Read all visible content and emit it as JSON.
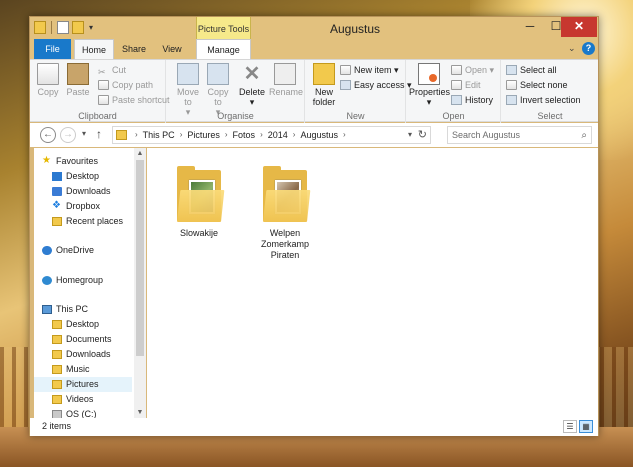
{
  "window": {
    "title": "Augustus",
    "contextual_tab_group": "Picture Tools",
    "controls": {
      "minimize": "─",
      "maximize": "☐",
      "close": "✕"
    }
  },
  "ribbon_tabs": [
    "File",
    "Home",
    "Share",
    "View",
    "Manage"
  ],
  "ribbon": {
    "clipboard": {
      "label": "Clipboard",
      "copy": "Copy",
      "paste": "Paste",
      "cut": "Cut",
      "copy_path": "Copy path",
      "paste_shortcut": "Paste shortcut"
    },
    "organise": {
      "label": "Organise",
      "move_to": "Move to",
      "copy_to": "Copy to",
      "delete": "Delete",
      "rename": "Rename"
    },
    "new": {
      "label": "New",
      "new_folder": "New folder",
      "new_item": "New item",
      "easy_access": "Easy access"
    },
    "open": {
      "label": "Open",
      "properties": "Properties",
      "open": "Open",
      "edit": "Edit",
      "history": "History"
    },
    "select": {
      "label": "Select",
      "select_all": "Select all",
      "select_none": "Select none",
      "invert_selection": "Invert selection"
    }
  },
  "address": {
    "breadcrumbs": [
      "This PC",
      "Pictures",
      "Fotos",
      "2014",
      "Augustus"
    ],
    "search_placeholder": "Search Augustus"
  },
  "navigation": {
    "favourites": "Favourites",
    "favourite_items": [
      "Desktop",
      "Downloads",
      "Dropbox",
      "Recent places"
    ],
    "onedrive": "OneDrive",
    "homegroup": "Homegroup",
    "this_pc": "This PC",
    "pc_items": [
      "Desktop",
      "Documents",
      "Downloads",
      "Music",
      "Pictures",
      "Videos",
      "OS (C:)"
    ],
    "selected": "Pictures"
  },
  "folders": [
    {
      "name": "Slowakije"
    },
    {
      "name": "Welpen\nZomerkamp\nPiraten"
    }
  ],
  "status": {
    "item_count": "2 items"
  },
  "colors": {
    "file_tab": "#1979ca",
    "context_tab": "#f6e98a",
    "close_button": "#c7372f",
    "frame": "#e2c17e"
  }
}
